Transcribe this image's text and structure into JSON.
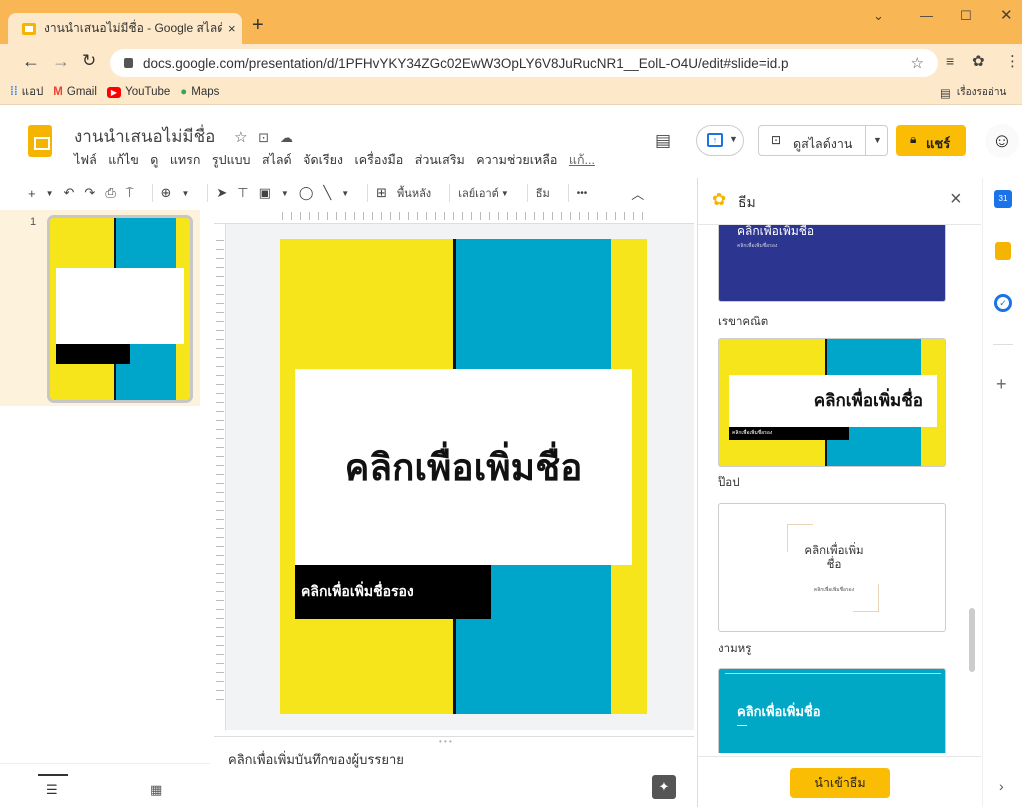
{
  "browser": {
    "tab_title": "งานนำเสนอไม่มีชื่อ - Google สไลด์",
    "tab_close": "×",
    "new_tab": "+",
    "url": "docs.google.com/presentation/d/1PFHvYKY34ZGc02EwW3OpLY6V8JuRucNR1__EolL-O4U/edit#slide=id.p",
    "bookmarks": [
      "แอป",
      "Gmail",
      "YouTube",
      "Maps"
    ],
    "reading_list": "เรื่องรออ่าน"
  },
  "app": {
    "doc_title": "งานนำเสนอไม่มีชื่อ",
    "menus": [
      "ไฟล์",
      "แก้ไข",
      "ดู",
      "แทรก",
      "รูปแบบ",
      "สไลด์",
      "จัดเรียง",
      "เครื่องมือ",
      "ส่วนเสริม",
      "ความช่วยเหลือ",
      "แก้..."
    ],
    "slideshow_label": "ดูสไลด์งาน",
    "share_label": "แชร์",
    "toolbar": {
      "background": "พื้นหลัง",
      "layout": "เลย์เอาต์",
      "theme": "ธีม",
      "more": "•••"
    }
  },
  "filmstrip": {
    "slide_number": "1"
  },
  "slide": {
    "title": "คลิกเพื่อเพิ่มชื่อ",
    "subtitle": "คลิกเพื่อเพิ่มชื่อรอง"
  },
  "notes": {
    "placeholder": "คลิกเพื่อเพิ่มบันทึกของผู้บรรยาย"
  },
  "themes_panel": {
    "title": "ธีม",
    "close": "×",
    "themes": [
      {
        "name": "",
        "preview_title": "คลิกเพื่อเพิ่มชื่อ",
        "preview_sub": "คลิกเพื่อเพิ่มชื่อรอง"
      },
      {
        "name": "เรขาคณิต",
        "preview_title": "คลิกเพื่อเพิ่มชื่อ",
        "preview_sub": "คลิกเพื่อเพิ่มชื่อรอง"
      },
      {
        "name": "ป๊อป",
        "preview_title": "คลิกเพื่อเพิ่ม\nชื่อ",
        "preview_sub": "คลิกเพื่อเพิ่มชื่อรอง"
      },
      {
        "name": "งามหรู",
        "preview_title": "คลิกเพื่อเพิ่มชื่อ",
        "preview_sub": ""
      }
    ],
    "import_label": "นำเข้าธีม"
  },
  "colors": {
    "yellow": "#f5e51a",
    "cyan": "#00a6c9",
    "navy": "#2c3690",
    "teal": "#00a8c5",
    "share": "#fbbc04",
    "tabbar": "#f9b654"
  }
}
